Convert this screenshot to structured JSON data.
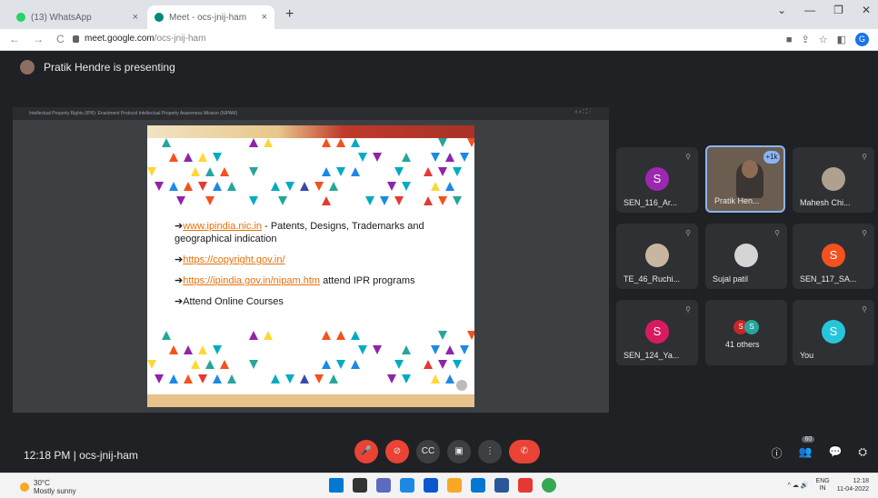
{
  "browser": {
    "tabs": [
      {
        "title": "(13) WhatsApp",
        "close": "×",
        "color": "#25d366"
      },
      {
        "title": "Meet - ocs-jnij-ham",
        "close": "×",
        "color": "#00897b"
      }
    ],
    "new_tab": "+",
    "window_controls": [
      "⌄",
      "—",
      "❐",
      "✕"
    ],
    "url_host": "meet.google.com",
    "url_path": "/ocs-jnij-ham",
    "nav": [
      "←",
      "→",
      "C"
    ],
    "extensions": [
      "■",
      "⇪",
      "☆",
      "◧"
    ],
    "profile_initial": "G"
  },
  "meet": {
    "presenting_banner": "Pratik Hendre is presenting",
    "presentation_title": "Intellectual Property Rights (IPR): Enactment Protocol Intellectual Property Awareness Mission (NIPAM)",
    "present_tools": "‹ › ⛶ ⋮",
    "slide": {
      "items": [
        {
          "arrow": "➔",
          "link": "www.ipindia.nic.in",
          "text": " - Patents, Designs, Trademarks and geographical indication"
        },
        {
          "arrow": "➔",
          "link": "https://copyright.gov.in/",
          "text": ""
        },
        {
          "arrow": "➔",
          "link": "https://ipindia.gov.in/nipam.htm",
          "text": "  attend IPR programs"
        },
        {
          "arrow": "➔",
          "link": "",
          "text": "Attend Online Courses"
        }
      ]
    },
    "tiles": [
      {
        "name": "SEN_116_Ar...",
        "initial": "S",
        "color": "#9c27b0"
      },
      {
        "name": "Pratik Hen...",
        "badge": "+1k"
      },
      {
        "name": "Mahesh Chi...",
        "initial": "",
        "color": "#b0a08e"
      },
      {
        "name": "TE_46_Ruchi...",
        "initial": "",
        "color": "#c9b6a0"
      },
      {
        "name": "Sujal patil",
        "initial": "",
        "color": "#d5d5d5"
      },
      {
        "name": "SEN_117_SA...",
        "initial": "S",
        "color": "#f4511e"
      },
      {
        "name": "SEN_124_Ya...",
        "initial": "S",
        "color": "#d81b60"
      },
      {
        "name": "41 others",
        "initial_a": "S",
        "initial_b": "S"
      },
      {
        "name": "You",
        "initial": "S",
        "color": "#26c6da"
      }
    ],
    "mic_glyph": "⚲"
  },
  "bottombar": {
    "time_room": "12:18 PM  |  ocs-jnij-ham",
    "controls": [
      "🎤",
      "⊘",
      "CC",
      "▣",
      "⋮",
      "✆"
    ],
    "right_controls": [
      "ⓘ",
      "👥",
      "💬",
      "⛭"
    ],
    "participant_count": "60"
  },
  "taskbar": {
    "weather_temp": "30°C",
    "weather_desc": "Mostly sunny",
    "tray_text": "^  ☁  🔊",
    "lang": "ENG",
    "region": "IN",
    "clock_time": "12:18",
    "clock_date": "11-04-2022",
    "icon_colors": [
      "#0078d4",
      "#333333",
      "#5c6bc0",
      "#1e88e5",
      "#0b57d0",
      "#f9a825",
      "#0078d4",
      "#2b579a",
      "#e53935",
      "#34a853"
    ]
  }
}
